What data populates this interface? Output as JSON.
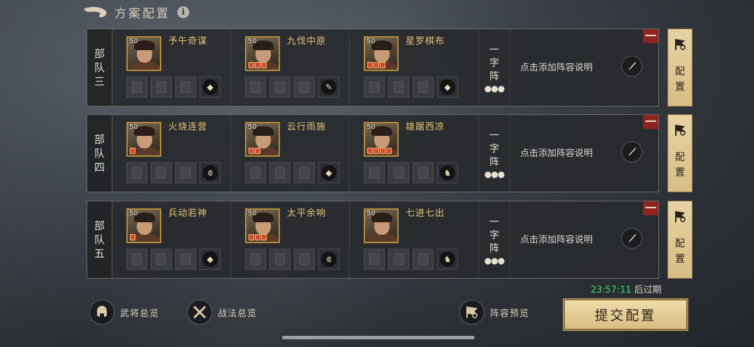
{
  "header": {
    "title": "方案配置",
    "info": "i"
  },
  "troops": [
    {
      "label": [
        "部",
        "队",
        "三"
      ],
      "generals": [
        {
          "level": "50",
          "name": "予午奇谋",
          "stars": 0,
          "skill_icon": "shield-icon",
          "skill_glyph": "◆"
        },
        {
          "level": "50",
          "name": "九伐中原",
          "stars": 3,
          "skill_icon": "spear-icon",
          "skill_glyph": "✎"
        },
        {
          "level": "50",
          "name": "星罗棋布",
          "stars": 3,
          "skill_icon": "shield-icon",
          "skill_glyph": "◆"
        }
      ],
      "formation": [
        "一",
        "字",
        "阵"
      ],
      "description": "点击添加阵容说明"
    },
    {
      "label": [
        "部",
        "队",
        "四"
      ],
      "generals": [
        {
          "level": "50",
          "name": "火烧连营",
          "stars": 1,
          "skill_icon": "bow-icon",
          "skill_glyph": "⟃"
        },
        {
          "level": "50",
          "name": "云行雨施",
          "stars": 2,
          "skill_icon": "shield-icon",
          "skill_glyph": "◆"
        },
        {
          "level": "50",
          "name": "雄踞西凉",
          "stars": 4,
          "skill_icon": "horse-icon",
          "skill_glyph": "♞"
        }
      ],
      "formation": [
        "一",
        "字",
        "阵"
      ],
      "description": "点击添加阵容说明"
    },
    {
      "label": [
        "部",
        "队",
        "五"
      ],
      "generals": [
        {
          "level": "50",
          "name": "兵动若神",
          "stars": 1,
          "skill_icon": "shield-icon",
          "skill_glyph": "◆"
        },
        {
          "level": "50",
          "name": "太平余响",
          "stars": 3,
          "skill_icon": "bow-icon",
          "skill_glyph": "⟃"
        },
        {
          "level": "50",
          "name": "七进七出",
          "stars": 0,
          "skill_icon": "horse-icon",
          "skill_glyph": "♞"
        }
      ],
      "formation": [
        "一",
        "字",
        "阵"
      ],
      "description": "点击添加阵容说明"
    }
  ],
  "config_button": [
    "配",
    "置"
  ],
  "remove_label": "一",
  "formation_dots": "●●●",
  "expire": {
    "time": "23:57:11",
    "suffix": "后过期"
  },
  "footer": {
    "generals_overview": "武将总览",
    "tactics_overview": "战法总览",
    "lineup_preview": "阵容预览",
    "submit": "提交配置"
  },
  "colors": {
    "accent_gold": "#e2c373",
    "remove_red": "#8e2420",
    "timer_green": "#3fd46a",
    "button_parchment": "#e6d2a4"
  }
}
